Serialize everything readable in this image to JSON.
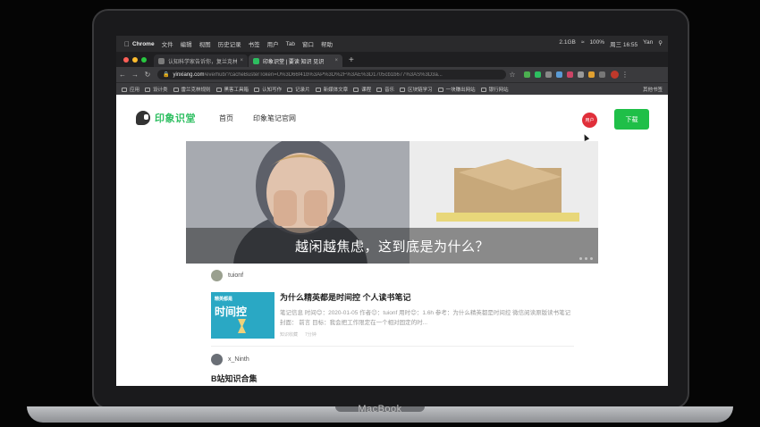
{
  "laptop": {
    "brand": "MacBook"
  },
  "menubar": {
    "app": "Chrome",
    "items": [
      "文件",
      "编辑",
      "视图",
      "历史记录",
      "书签",
      "用户",
      "Tab",
      "窗口",
      "帮助"
    ],
    "status": [
      "2.1GB",
      "100%",
      "周三 16:55",
      "Yan"
    ]
  },
  "tabs": [
    {
      "label": "认知科学家告诉你，复兰克林的...",
      "active": false
    },
    {
      "label": "印象识堂 | 要读 知识 见识",
      "active": true
    }
  ],
  "address_bar": {
    "host": "yinxiang.com",
    "path": "/everhub/?cacheBusterToken=U%3D66f41b%3AP%3D%2F%3AE%3D1705cb1b677%3AS%3D3a..."
  },
  "bookmarks": {
    "items": [
      "应用",
      "设计类",
      "雷兰克林规则",
      "黑客工具箱",
      "认知写作",
      "记录片",
      "新媒体文章",
      "课程",
      "音乐",
      "区块链学习",
      "一块赚出网站",
      "银行网站"
    ],
    "other": "其他书签"
  },
  "site": {
    "logo": "印象识堂",
    "nav": [
      "首页",
      "印象笔记官网"
    ],
    "avatar_text": "用户",
    "download": "下载"
  },
  "banner": {
    "caption": "越闲越焦虑，这到底是为什么？"
  },
  "feed": [
    {
      "author": "tuionf",
      "title": "为什么精英都是时间控 个人读书笔记",
      "excerpt": "笔记信息 时间😊：2020-01-05 作者😉：tuionf 用时😊：1.6h 参考：为什么精英都是时间控 微信阅读原版读书笔记 封面： 前言 目标：我会把工作限定在一个相对固定的时...",
      "thumb_top": "精英都是",
      "thumb_big": "时间控",
      "meta": [
        "知识收藏",
        "7分钟"
      ]
    },
    {
      "author": "x_Ninth",
      "title": "B站知识合集"
    }
  ],
  "colors": {
    "brand_green": "#2dbe60",
    "download_green": "#1fbf48",
    "avatar_red": "#e02f3a"
  }
}
